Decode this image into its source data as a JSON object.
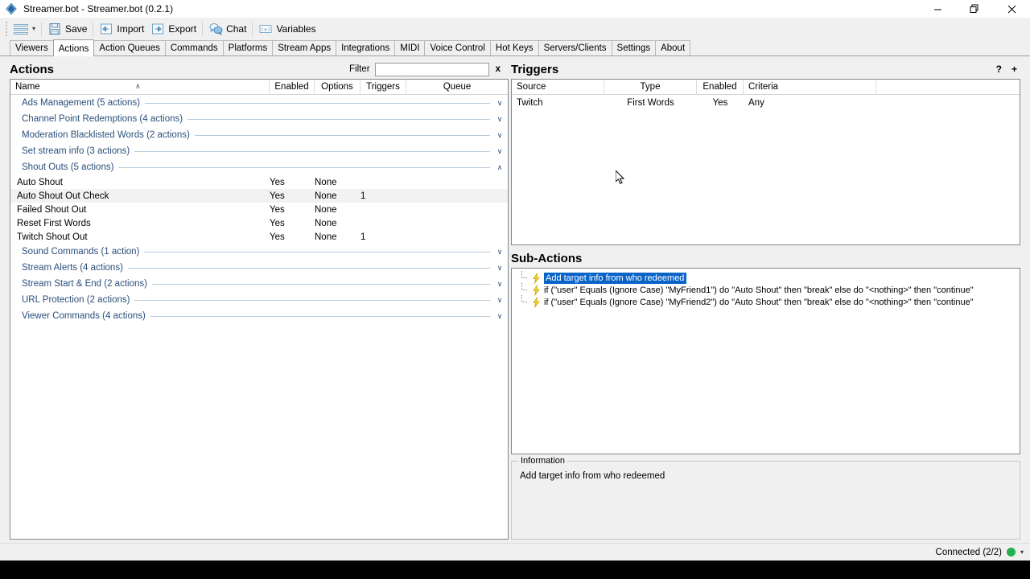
{
  "window": {
    "title": "Streamer.bot - Streamer.bot (0.2.1)",
    "icon": "streamerbot-logo-icon",
    "controls": [
      {
        "name": "minimize",
        "glyph": "—"
      },
      {
        "name": "maximize",
        "glyph": "❐"
      },
      {
        "name": "close",
        "glyph": "✕"
      }
    ]
  },
  "toolbar": {
    "menu_icon": "hamburger-menu-icon",
    "menu_caret": "▾",
    "items": [
      {
        "label": "Save",
        "icon": "save-floppy-icon"
      },
      {
        "label": "Import",
        "icon": "import-arrow-icon"
      },
      {
        "label": "Export",
        "icon": "export-arrow-icon"
      },
      {
        "label": "Chat",
        "icon": "chat-bubbles-icon"
      },
      {
        "label": "Variables",
        "icon": "variables-icon"
      }
    ]
  },
  "tabs": {
    "active": "Actions",
    "items": [
      "Viewers",
      "Actions",
      "Action Queues",
      "Commands",
      "Platforms",
      "Stream Apps",
      "Integrations",
      "MIDI",
      "Voice Control",
      "Hot Keys",
      "Servers/Clients",
      "Settings",
      "About"
    ]
  },
  "actions_panel": {
    "title": "Actions",
    "filter_label": "Filter",
    "filter_value": "",
    "filter_placeholder": "",
    "clear_label": "x",
    "columns": [
      "Name",
      "Enabled",
      "Options",
      "Triggers",
      "Queue"
    ],
    "sort_indicator": "∧",
    "groups": [
      {
        "label": "Ads Management (5 actions)",
        "expanded": false,
        "chevron": "∨",
        "rows": []
      },
      {
        "label": "Channel Point Redemptions (4 actions)",
        "expanded": false,
        "chevron": "∨",
        "rows": []
      },
      {
        "label": "Moderation Blacklisted Words (2 actions)",
        "expanded": false,
        "chevron": "∨",
        "rows": []
      },
      {
        "label": "Set stream info (3 actions)",
        "expanded": false,
        "chevron": "∨",
        "rows": []
      },
      {
        "label": "Shout Outs (5 actions)",
        "expanded": true,
        "chevron": "∧",
        "rows": [
          {
            "name": "Auto Shout",
            "enabled": "Yes",
            "options": "None",
            "triggers": "",
            "queue": "",
            "selected": false
          },
          {
            "name": "Auto Shout Out Check",
            "enabled": "Yes",
            "options": "None",
            "triggers": "1",
            "queue": "",
            "selected": true
          },
          {
            "name": "Failed Shout Out",
            "enabled": "Yes",
            "options": "None",
            "triggers": "",
            "queue": "",
            "selected": false
          },
          {
            "name": "Reset First Words",
            "enabled": "Yes",
            "options": "None",
            "triggers": "",
            "queue": "",
            "selected": false
          },
          {
            "name": "Twitch Shout Out",
            "enabled": "Yes",
            "options": "None",
            "triggers": "1",
            "queue": "",
            "selected": false
          }
        ]
      },
      {
        "label": "Sound Commands (1 action)",
        "expanded": false,
        "chevron": "∨",
        "rows": []
      },
      {
        "label": "Stream Alerts (4 actions)",
        "expanded": false,
        "chevron": "∨",
        "rows": []
      },
      {
        "label": "Stream Start & End (2 actions)",
        "expanded": false,
        "chevron": "∨",
        "rows": []
      },
      {
        "label": "URL Protection (2 actions)",
        "expanded": false,
        "chevron": "∨",
        "rows": []
      },
      {
        "label": "Viewer Commands (4 actions)",
        "expanded": false,
        "chevron": "∨",
        "rows": []
      }
    ]
  },
  "triggers_panel": {
    "title": "Triggers",
    "help_label": "?",
    "add_label": "+",
    "columns": [
      "Source",
      "Type",
      "Enabled",
      "Criteria"
    ],
    "rows": [
      {
        "source": "Twitch",
        "type": "First Words",
        "enabled": "Yes",
        "criteria": "Any"
      }
    ]
  },
  "subactions_panel": {
    "title": "Sub-Actions",
    "rows": [
      {
        "text": "Add target info from who redeemed",
        "icon": "lightning-bolt-icon",
        "selected": true
      },
      {
        "text": "if (\"user\" Equals (Ignore Case) \"MyFriend1\") do \"Auto Shout\" then \"break\" else do \"<nothing>\" then \"continue\"",
        "icon": "lightning-bolt-icon",
        "selected": false
      },
      {
        "text": "if (\"user\" Equals (Ignore Case) \"MyFriend2\") do \"Auto Shout\" then \"break\" else do \"<nothing>\" then \"continue\"",
        "icon": "lightning-bolt-icon",
        "selected": false
      }
    ]
  },
  "information_panel": {
    "legend": "Information",
    "text": "Add target info from who redeemed"
  },
  "statusbar": {
    "text": "Connected (2/2)",
    "indicator_color": "#22b14c",
    "caret": "▾"
  },
  "colors": {
    "group_text": "#2a4f7c",
    "selection": "#0a64c8",
    "window_bg": "#f0f0f0"
  }
}
